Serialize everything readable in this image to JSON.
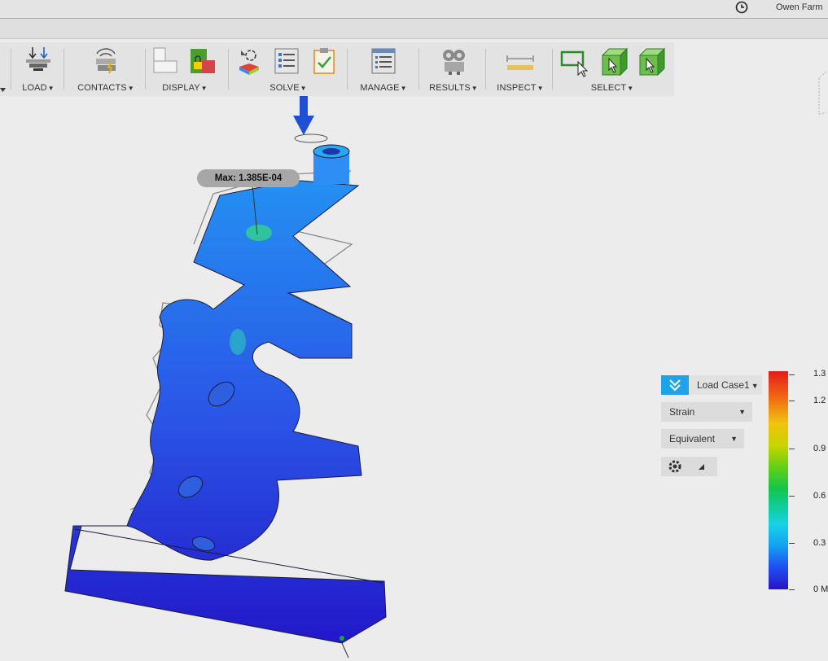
{
  "header": {
    "user_name": "Owen Farm"
  },
  "toolbar": {
    "groups": [
      {
        "label": "LOAD",
        "icon": "load-icon"
      },
      {
        "label": "CONTACTS",
        "icon": "contacts-icon"
      },
      {
        "label": "DISPLAY",
        "icon": "display-icon"
      },
      {
        "label": "SOLVE",
        "icon": "solve-icon"
      },
      {
        "label": "MANAGE",
        "icon": "manage-icon"
      },
      {
        "label": "RESULTS",
        "icon": "results-icon"
      },
      {
        "label": "INSPECT",
        "icon": "inspect-icon"
      },
      {
        "label": "SELECT",
        "icon": "select-icon"
      }
    ],
    "caret": "▼",
    "active_color": "#3d7fbf"
  },
  "viewport": {
    "max_label": "Max: 1.385E-04"
  },
  "results_panel": {
    "load_case": "Load Case1",
    "result_type": "Strain",
    "component": "Equivalent",
    "legend_labels": [
      "1.3",
      "1.2",
      "0.9",
      "0.6",
      "0.3",
      "0 M"
    ]
  }
}
